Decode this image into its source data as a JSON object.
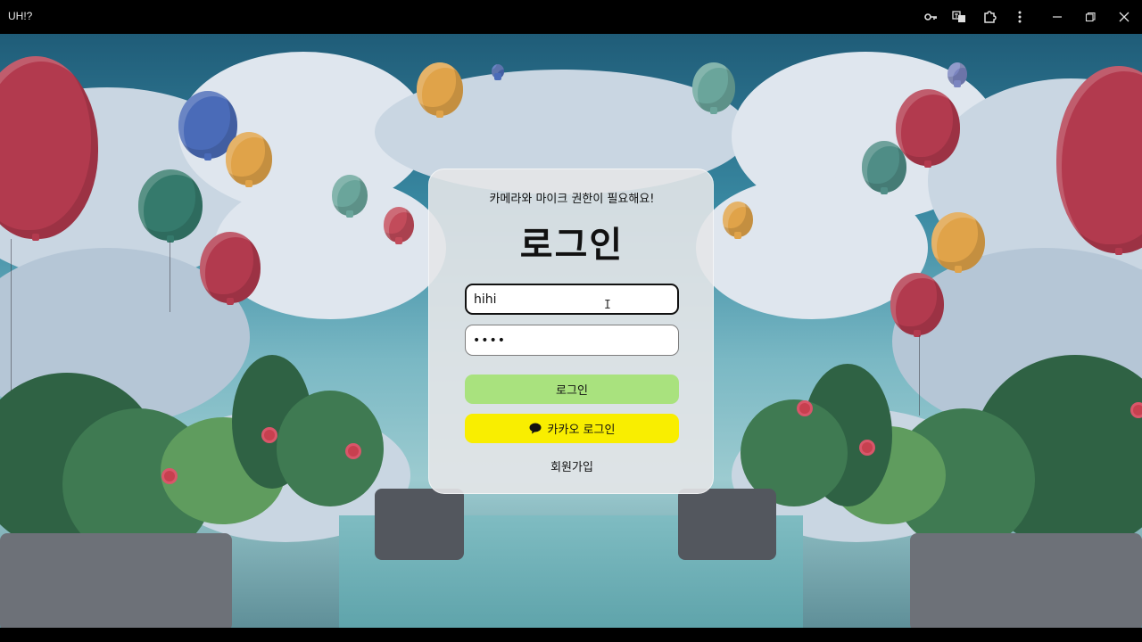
{
  "window": {
    "title": "UH!?",
    "icons": [
      "key-icon",
      "translate-icon",
      "extensions-icon",
      "more-menu-icon",
      "minimize-icon",
      "restore-icon",
      "close-icon"
    ]
  },
  "login": {
    "permission_notice": "카메라와 마이크 권한이 필요해요!",
    "title": "로그인",
    "username_value": "hihi",
    "password_value": "••••",
    "login_button": "로그인",
    "kakao_button": "카카오 로그인",
    "signup_link": "회원가입"
  },
  "colors": {
    "login_button": "#a9e27e",
    "kakao_button": "#f9ee00",
    "card_background": "#e4e6e8"
  }
}
